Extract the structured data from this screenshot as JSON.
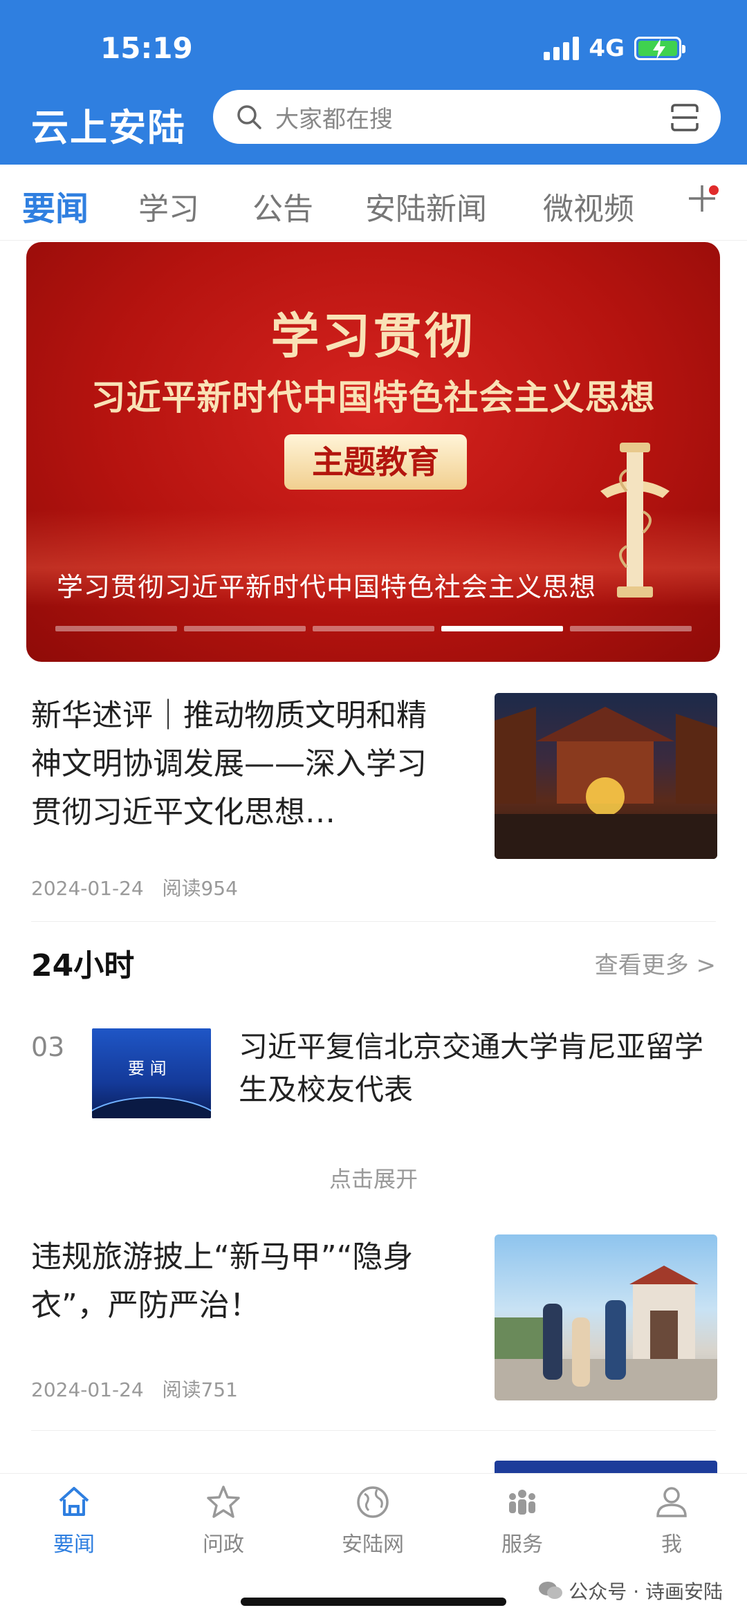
{
  "status_bar": {
    "time": "15:19",
    "network": "4G"
  },
  "header": {
    "app_title": "云上安陆",
    "search_placeholder": "大家都在搜"
  },
  "tabs": [
    {
      "label": "要闻",
      "active": true
    },
    {
      "label": "学习",
      "active": false
    },
    {
      "label": "公告",
      "active": false
    },
    {
      "label": "安陆新闻",
      "active": false
    },
    {
      "label": "微视频",
      "active": false
    }
  ],
  "banner": {
    "title_line1": "学习贯彻",
    "title_line2": "习近平新时代中国特色社会主义思想",
    "badge": "主题教育",
    "caption": "学习贯彻习近平新时代中国特色社会主义思想",
    "slide_count": 5,
    "active_slide": 4
  },
  "articles": [
    {
      "title": "新华述评｜推动物质文明和精神文明协调发展——深入学习贯彻习近平文化思想…",
      "date": "2024-01-24",
      "reads": "阅读954"
    },
    {
      "title": "违规旅游披上“新马甲”“隐身衣”，严防严治！",
      "date": "2024-01-24",
      "reads": "阅读751"
    }
  ],
  "hot24": {
    "section_title": "24小时",
    "see_more": "查看更多 >",
    "item": {
      "rank": "03",
      "thumb_text": "要 闻",
      "title": "习近平复信北京交通大学肯尼亚留学生及校友代表"
    },
    "expand": "点击展开"
  },
  "bottom_nav": [
    {
      "label": "要闻",
      "icon": "home-icon",
      "active": true
    },
    {
      "label": "问政",
      "icon": "star-icon",
      "active": false
    },
    {
      "label": "安陆网",
      "icon": "globe-icon",
      "active": false
    },
    {
      "label": "服务",
      "icon": "people-icon",
      "active": false
    },
    {
      "label": "我",
      "icon": "user-icon",
      "active": false
    }
  ],
  "watermark": "公众号 · 诗画安陆",
  "colors": {
    "brand_blue": "#2f7fe0",
    "banner_red": "#c0160f",
    "badge_gold": "#f1cf8f"
  }
}
